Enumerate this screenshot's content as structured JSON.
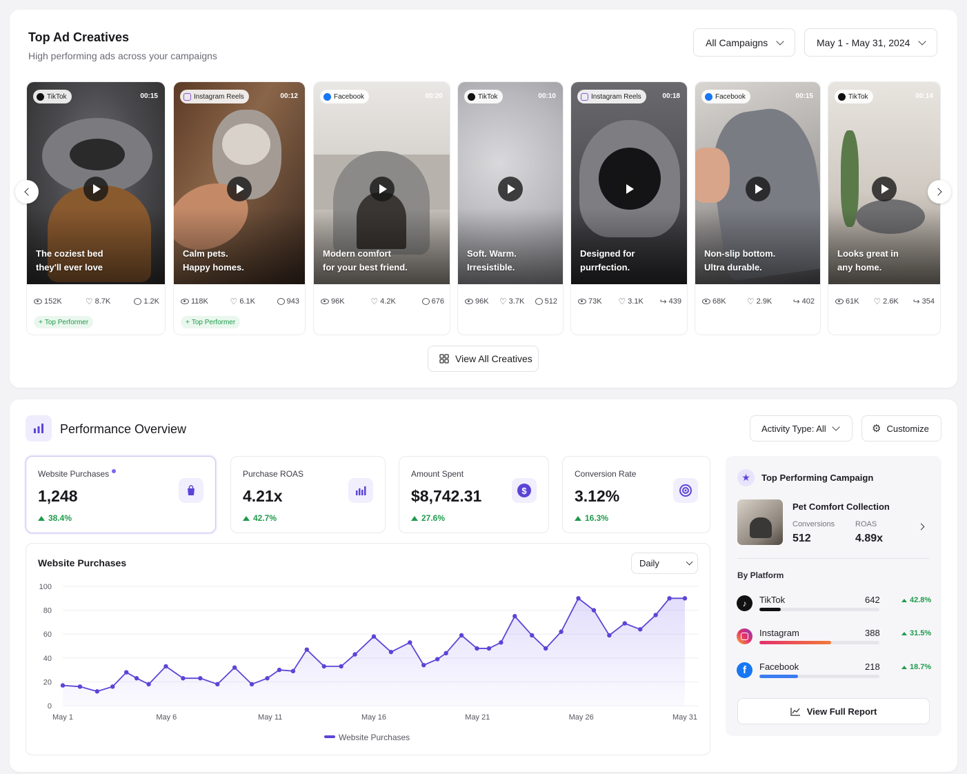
{
  "creatives_section": {
    "title": "Top Ad Creatives",
    "subtitle": "High performing ads across your campaigns",
    "campaign_filter": "All Campaigns",
    "date_range": "May 1 - May 31, 2024",
    "view_all_label": "View All Creatives",
    "top_performer_label": "Top Performer",
    "cards": [
      {
        "platform": "TikTok",
        "duration": "00:15",
        "caption": "The coziest bed\nthey'll ever love",
        "views": "152K",
        "likes": "8.7K",
        "comments": "1.2K",
        "top": true
      },
      {
        "platform": "Instagram Reels",
        "duration": "00:12",
        "caption": "Calm pets.\nHappy homes.",
        "views": "118K",
        "likes": "6.1K",
        "comments": "943",
        "top": true
      },
      {
        "platform": "Facebook",
        "duration": "00:20",
        "caption": "Modern comfort\nfor your best friend.",
        "views": "96K",
        "likes": "4.2K",
        "comments": "676",
        "top": false
      },
      {
        "platform": "TikTok",
        "duration": "00:10",
        "caption": "Soft. Warm.\nIrresistible.",
        "views": "96K",
        "likes": "3.7K",
        "comments": "512",
        "top": false
      },
      {
        "platform": "Instagram Reels",
        "duration": "00:18",
        "caption": "Designed for\npurrfection.",
        "views": "73K",
        "likes": "3.1K",
        "shares": "439",
        "top": false
      },
      {
        "platform": "Facebook",
        "duration": "00:15",
        "caption": "Non-slip bottom.\nUltra durable.",
        "views": "68K",
        "likes": "2.9K",
        "shares": "402",
        "top": false
      },
      {
        "platform": "TikTok",
        "duration": "00:14",
        "caption": "Looks great in\nany home.",
        "views": "61K",
        "likes": "2.6K",
        "shares": "354",
        "top": false
      }
    ]
  },
  "performance": {
    "title": "Performance Overview",
    "activity_filter": "Activity Type: All",
    "customize_label": "Customize",
    "metrics": [
      {
        "label": "Website Purchases",
        "value": "1,248",
        "change": "38.4%",
        "icon": "shopping-bag-icon"
      },
      {
        "label": "Purchase ROAS",
        "value": "4.21x",
        "change": "42.7%",
        "icon": "bar-chart-icon"
      },
      {
        "label": "Amount Spent",
        "value": "$8,742.31",
        "change": "27.6%",
        "icon": "dollar-icon"
      },
      {
        "label": "Conversion Rate",
        "value": "3.12%",
        "change": "16.3%",
        "icon": "target-icon"
      }
    ],
    "chart_title": "Website Purchases",
    "granularity": "Daily",
    "legend_label": "Website Purchases",
    "accent_color": "#5b45d6"
  },
  "chart_data": {
    "type": "area",
    "title": "Website Purchases",
    "x": [
      "May 1",
      "May 2",
      "May 3",
      "May 4",
      "May 5",
      "May 6",
      "May 7",
      "May 8",
      "May 9",
      "May 10",
      "May 11",
      "May 12",
      "May 13",
      "May 14",
      "May 15",
      "May 16",
      "May 17",
      "May 18",
      "May 19",
      "May 20",
      "May 21",
      "May 22",
      "May 23",
      "May 24",
      "May 25",
      "May 26",
      "May 27",
      "May 28",
      "May 29",
      "May 30",
      "May 31"
    ],
    "x_ticks": [
      "May 1",
      "May 6",
      "May 11",
      "May 16",
      "May 21",
      "May 26",
      "May 31"
    ],
    "series": [
      {
        "name": "Website Purchases",
        "values": [
          17,
          16,
          12,
          16,
          28,
          23,
          18,
          33,
          23,
          23,
          18,
          32,
          18,
          23,
          30,
          29,
          47,
          33,
          33,
          43,
          58,
          45,
          53,
          34,
          39,
          44,
          59,
          48,
          48,
          53,
          75,
          59,
          48,
          62,
          90,
          80,
          59,
          69,
          64,
          76,
          90,
          90
        ],
        "x_pos": [
          0,
          1,
          2,
          2.9,
          3.7,
          4.3,
          5,
          6,
          7,
          8,
          9,
          10,
          11,
          11.9,
          12.6,
          13.4,
          14.2,
          15.2,
          16.2,
          17,
          18.1,
          19.1,
          20.2,
          21,
          21.8,
          22.3,
          23.2,
          24.1,
          24.8,
          25.5,
          26.3,
          27.3,
          28.1,
          29,
          30,
          30.9,
          31.8,
          32.7,
          33.6,
          34.5,
          35.3,
          36.2
        ]
      }
    ],
    "yticks": [
      0,
      20,
      40,
      60,
      80,
      100
    ],
    "ylim": [
      0,
      100
    ],
    "grid": true,
    "legend": "bottom"
  },
  "top_campaign": {
    "heading": "Top Performing Campaign",
    "name": "Pet Comfort Collection",
    "conversions_label": "Conversions",
    "conversions": "512",
    "roas_label": "ROAS",
    "roas": "4.89x",
    "by_platform_label": "By Platform",
    "platforms": [
      {
        "name": "TikTok",
        "value": "642",
        "change": "42.8%",
        "share": 0.18,
        "color": "#111111"
      },
      {
        "name": "Instagram",
        "value": "388",
        "change": "31.5%",
        "share": 0.6,
        "color": "#ee4b6a"
      },
      {
        "name": "Facebook",
        "value": "218",
        "change": "18.7%",
        "share": 0.32,
        "color": "#3b7cf0"
      }
    ],
    "report_label": "View Full Report"
  }
}
